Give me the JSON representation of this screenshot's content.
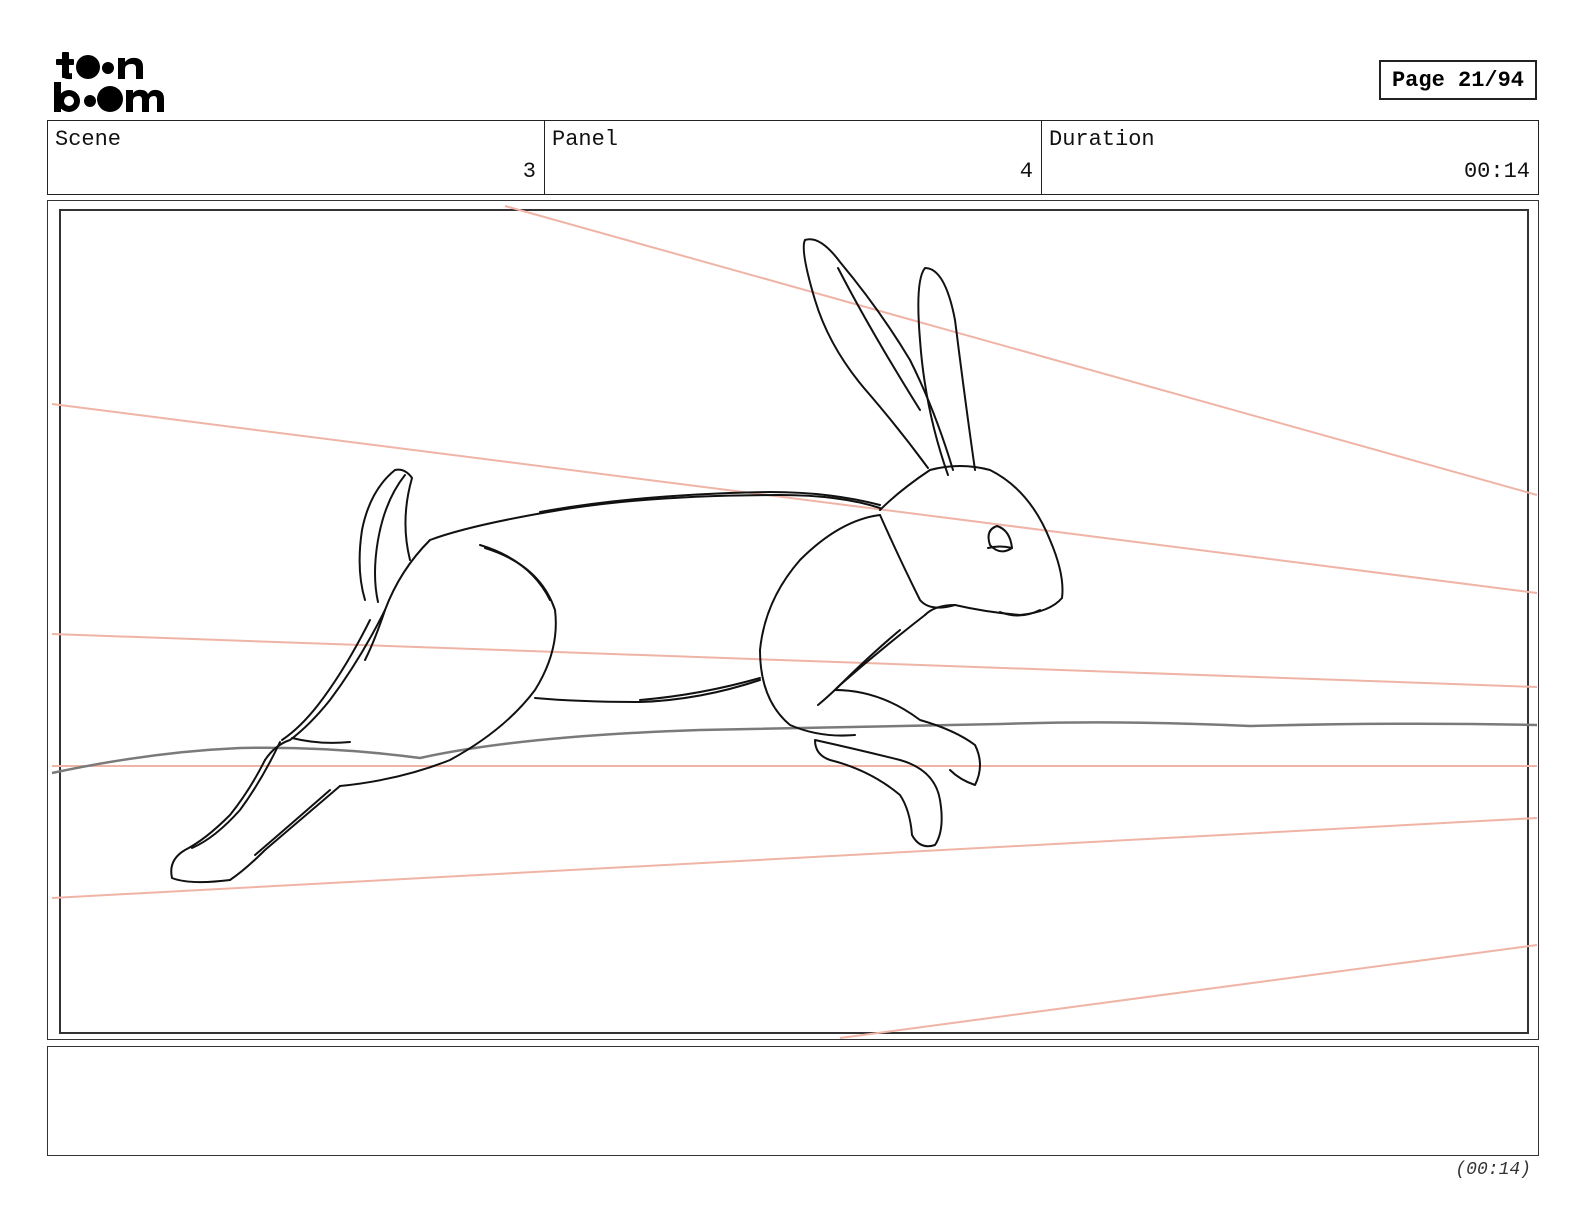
{
  "logo": {
    "text_top": "toon",
    "text_bottom": "boom",
    "icon": "toon-boom-logo"
  },
  "page": {
    "label": "Page 21/94"
  },
  "header": {
    "scene_label": "Scene",
    "scene_value": "3",
    "panel_label": "Panel",
    "panel_value": "4",
    "duration_label": "Duration",
    "duration_value": "00:14"
  },
  "panel_image": {
    "subject": "rabbit-sketch",
    "colors": {
      "guide_lines": "#f0b4a6",
      "ground_line": "#7a7a7a",
      "ink": "#111111"
    }
  },
  "notes": {
    "text": ""
  },
  "footer": {
    "duration": "(00:14)"
  }
}
